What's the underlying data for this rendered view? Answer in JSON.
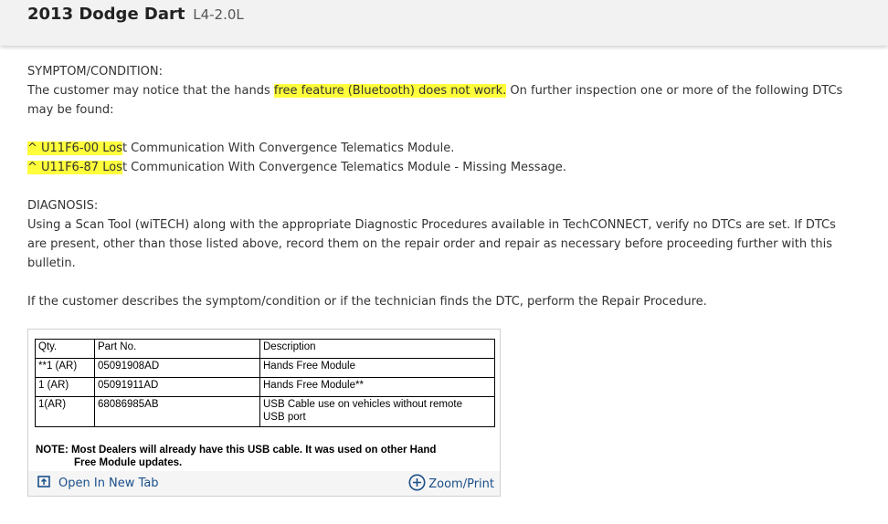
{
  "header": {
    "make_model": "2013 Dodge Dart",
    "engine": "L4-2.0L"
  },
  "content": {
    "symptom_heading": "SYMPTOM/CONDITION:",
    "symptom_pre": "The customer may notice that the hands ",
    "symptom_highlight": "free feature (Bluetooth) does not work.",
    "symptom_post": " On further inspection one or more of the following DTCs may be found:",
    "dtcs": [
      {
        "highlight": "^ U11F6-00 Los",
        "rest": "t Communication With Convergence Telematics Module."
      },
      {
        "highlight": "^ U11F6-87 Los",
        "rest": "t Communication With Convergence Telematics Module - Missing Message."
      }
    ],
    "diagnosis_heading": "DIAGNOSIS:",
    "diagnosis_text": "Using a Scan Tool (wiTECH) along with the appropriate Diagnostic Procedures available in TechCONNECT, verify no DTCs are set. If DTCs are present, other than those listed above, record them on the repair order and repair as necessary before proceeding further with this bulletin.",
    "repair_text": "If the customer describes the symptom/condition or if the technician finds the DTC, perform the Repair Procedure."
  },
  "parts_table": {
    "headers": [
      "Qty.",
      "Part No.",
      "Description"
    ],
    "rows": [
      [
        "**1 (AR)",
        "05091908AD",
        "Hands Free Module"
      ],
      [
        "1 (AR)",
        "05091911AD",
        "Hands Free Module**"
      ],
      [
        "1(AR)",
        "68086985AB",
        "USB Cable use on vehicles without remote USB port"
      ]
    ]
  },
  "note": {
    "line1": "NOTE: Most Dealers will already have this USB cable. It was used on other Hand",
    "line2": "Free Module updates."
  },
  "figure_toolbar": {
    "open_label": "Open In New Tab",
    "zoom_label": "Zoom/Print",
    "open_icon": "open-new-tab-icon",
    "zoom_icon": "zoom-plus-icon"
  },
  "colors": {
    "highlight": "#ffff3c",
    "link": "#1a4f8a",
    "header_bg": "#f2f2f2"
  }
}
